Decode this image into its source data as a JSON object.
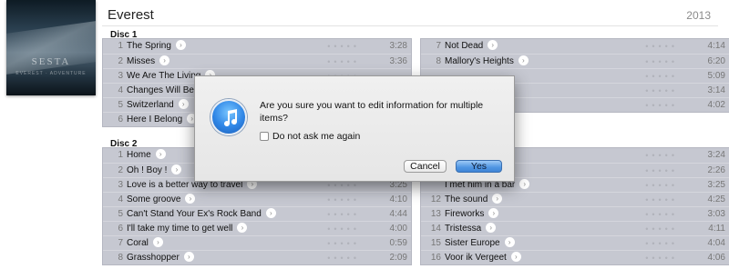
{
  "album": {
    "title": "Everest",
    "year": "2013",
    "art": {
      "band": "SESTA",
      "sub": "EVEREST · ADVENTURE"
    }
  },
  "discs": [
    {
      "label": "Disc 1",
      "columns": [
        [
          {
            "num": "1",
            "name": "The Spring",
            "time": "3:28"
          },
          {
            "num": "2",
            "name": "Misses",
            "time": "3:36"
          },
          {
            "num": "3",
            "name": "We Are The Living",
            "time": ""
          },
          {
            "num": "4",
            "name": "Changes Will Be L",
            "time": ""
          },
          {
            "num": "5",
            "name": "Switzerland",
            "time": ""
          },
          {
            "num": "6",
            "name": "Here I Belong",
            "time": ""
          }
        ],
        [
          {
            "num": "7",
            "name": "Not Dead",
            "time": "4:14"
          },
          {
            "num": "8",
            "name": "Mallory's Heights",
            "time": "6:20"
          },
          {
            "num": "",
            "name": "",
            "time": "5:09"
          },
          {
            "num": "",
            "name": "",
            "time": "3:14"
          },
          {
            "num": "",
            "name": "",
            "time": "4:02"
          }
        ]
      ]
    },
    {
      "label": "Disc 2",
      "columns": [
        [
          {
            "num": "1",
            "name": "Home",
            "time": ""
          },
          {
            "num": "2",
            "name": "Oh ! Boy !",
            "time": ""
          },
          {
            "num": "3",
            "name": "Love is a better way to travel",
            "time": "3:25"
          },
          {
            "num": "4",
            "name": "Some groove",
            "time": "4:10"
          },
          {
            "num": "5",
            "name": "Can't Stand Your Ex's Rock Band",
            "time": "4:44"
          },
          {
            "num": "6",
            "name": "I'll take my time to get well",
            "time": "4:00"
          },
          {
            "num": "7",
            "name": "Coral",
            "time": "0:59"
          },
          {
            "num": "8",
            "name": "Grasshopper",
            "time": "2:09"
          }
        ],
        [
          {
            "num": "",
            "name": "",
            "time": "3:24"
          },
          {
            "num": "",
            "name": "",
            "time": "2:26"
          },
          {
            "num": "",
            "name": "I met him in a bar",
            "time": "3:25"
          },
          {
            "num": "12",
            "name": "The sound",
            "time": "4:25"
          },
          {
            "num": "13",
            "name": "Fireworks",
            "time": "3:03"
          },
          {
            "num": "14",
            "name": "Tristessa",
            "time": "4:11"
          },
          {
            "num": "15",
            "name": "Sister Europe",
            "time": "4:04"
          },
          {
            "num": "16",
            "name": "Voor ik Vergeet",
            "time": "4:06"
          }
        ]
      ]
    }
  ],
  "dialog": {
    "message": "Are you sure you want to edit information for multiple items?",
    "checkbox_label": "Do not ask me again",
    "cancel_label": "Cancel",
    "confirm_label": "Yes",
    "icon": "itunes-note-icon"
  },
  "colors": {
    "track_bg": "#c6c8d1",
    "primary_button": "#4f95e2"
  }
}
